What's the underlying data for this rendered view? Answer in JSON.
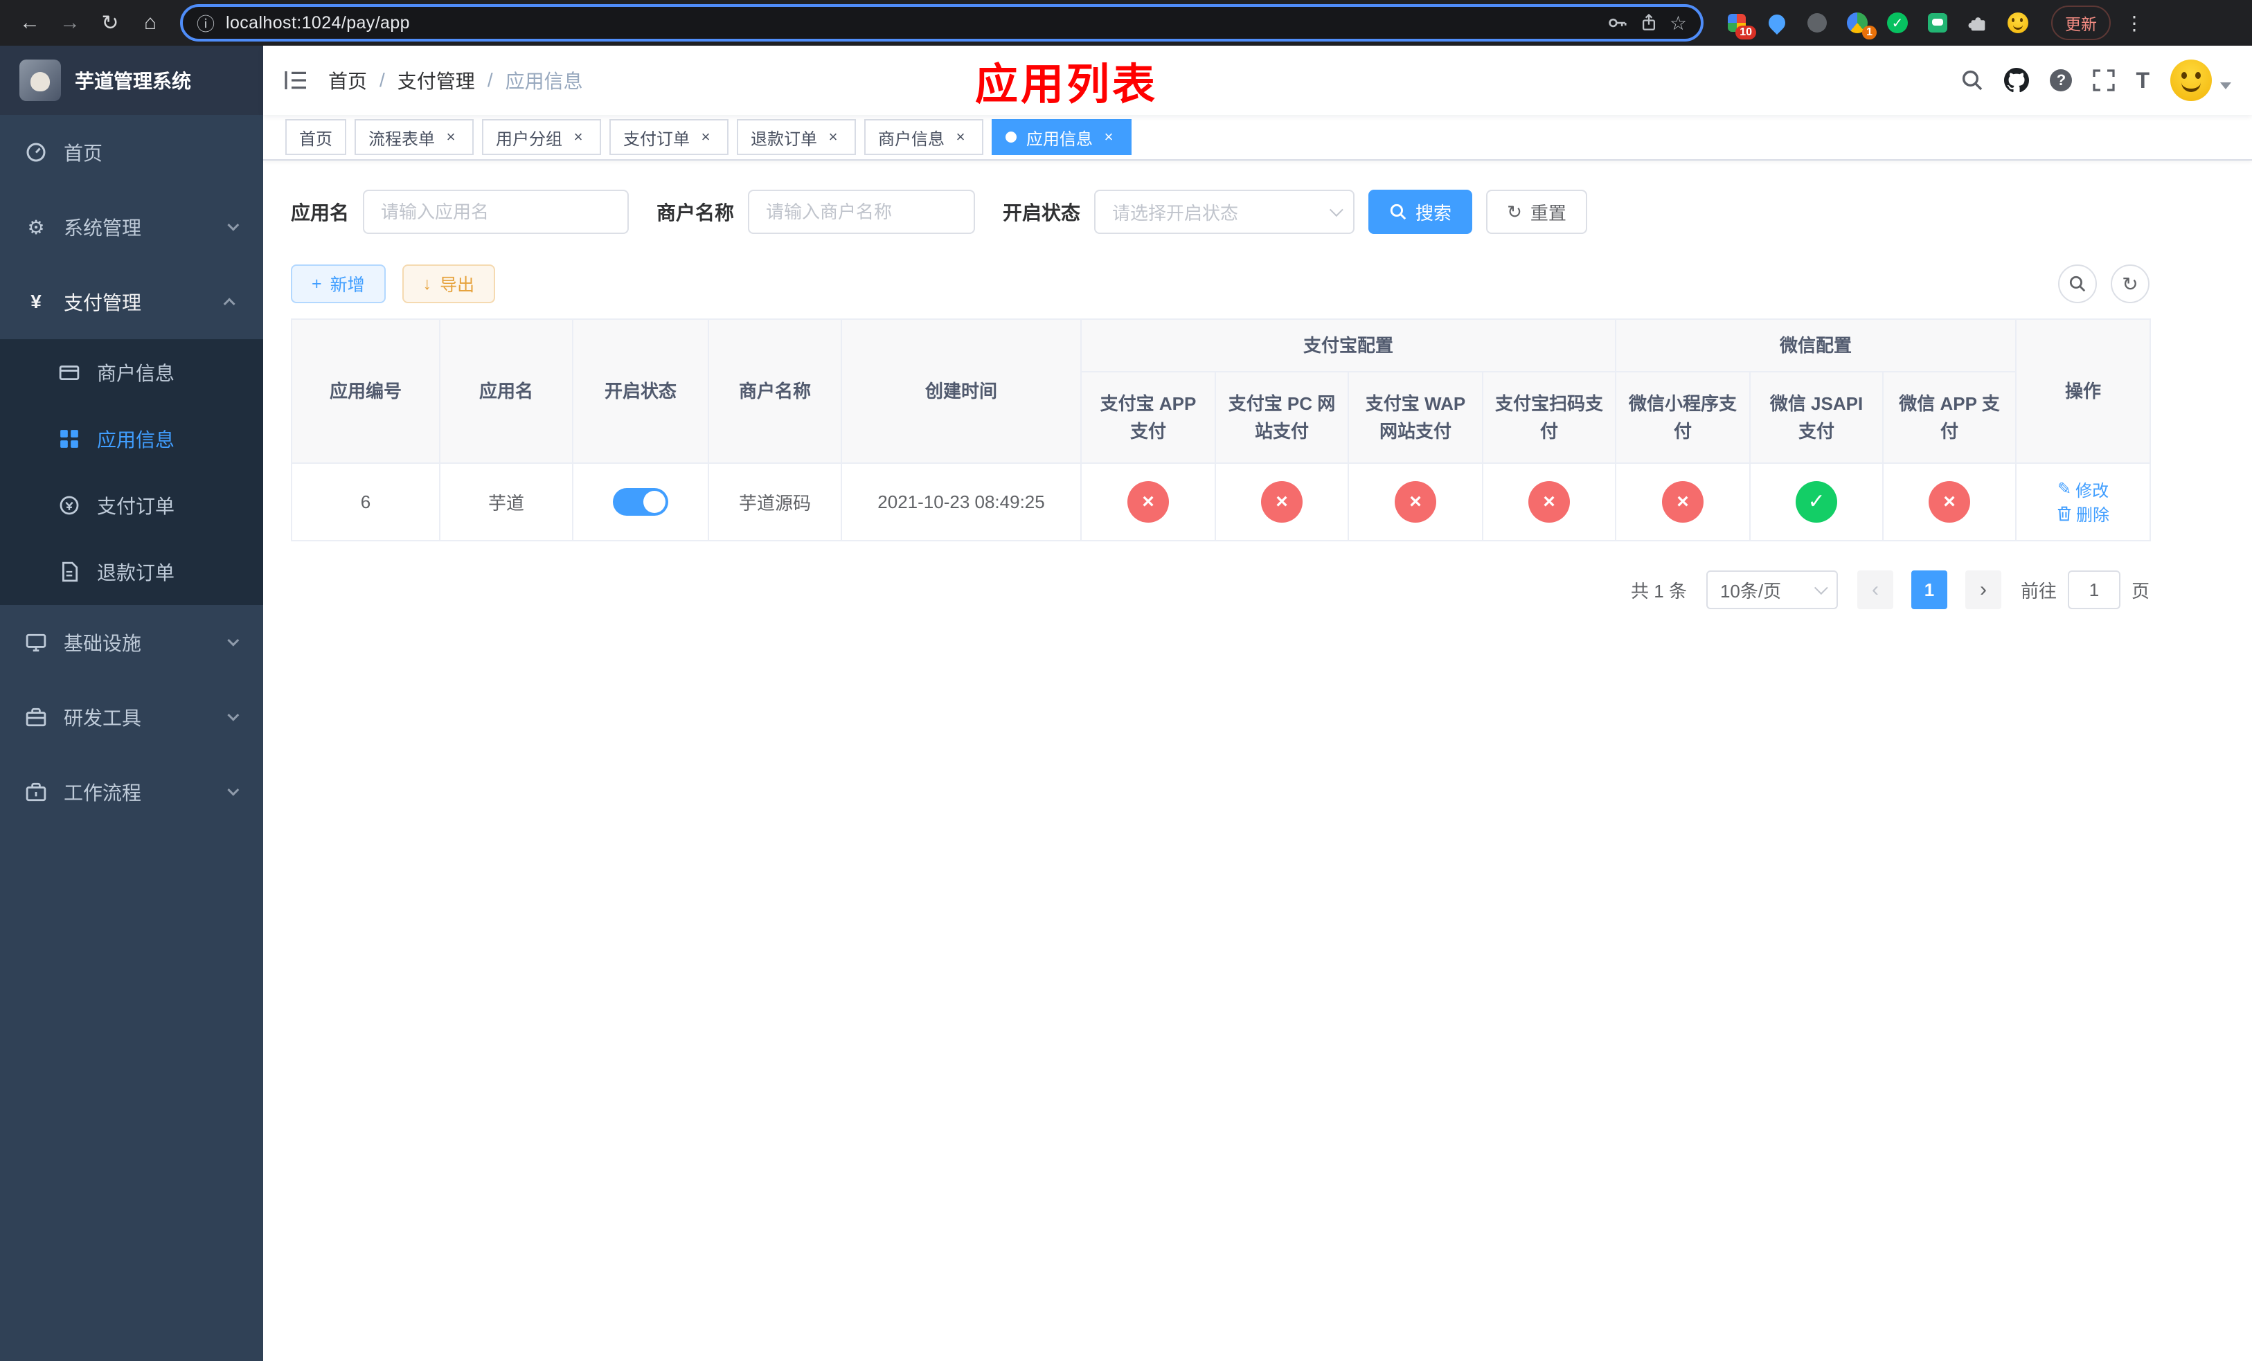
{
  "colors": {
    "accent": "#409eff",
    "danger": "#f56c6c",
    "success": "#13ce66",
    "warning": "#e6a23c",
    "title": "#ff0000",
    "sidebar_bg": "#304156",
    "sidebar_sub_bg": "#1f2d3d",
    "browser_bg": "#202124"
  },
  "icons": {
    "back": "←",
    "forward": "→",
    "reload": "↻",
    "home": "⌂",
    "info": "ⓘ",
    "star": "☆",
    "menu_dots": "⋮",
    "question": "?",
    "font_size": "T",
    "gear": "⚙",
    "yen": "¥",
    "refresh": "↻",
    "plus": "+",
    "download": "↓",
    "edit": "✎",
    "check": "✓",
    "cross": "×",
    "prev": "‹",
    "next": "›",
    "wechat_check": "✓"
  },
  "browser": {
    "url": "localhost:1024/pay/app",
    "update_label": "更新",
    "ext_badge_grid": "10",
    "ext_badge_multi": "1"
  },
  "sidebar": {
    "logo_title": "芋道管理系统",
    "items": [
      {
        "label": "首页"
      },
      {
        "label": "系统管理"
      },
      {
        "label": "支付管理",
        "children": [
          {
            "label": "商户信息"
          },
          {
            "label": "应用信息"
          },
          {
            "label": "支付订单"
          },
          {
            "label": "退款订单"
          }
        ]
      },
      {
        "label": "基础设施"
      },
      {
        "label": "研发工具"
      },
      {
        "label": "工作流程"
      }
    ]
  },
  "header": {
    "breadcrumb": [
      "首页",
      "支付管理",
      "应用信息"
    ],
    "breadcrumb_separator": "/",
    "page_title": "应用列表"
  },
  "tabbar": {
    "tabs": [
      {
        "label": "首页"
      },
      {
        "label": "流程表单"
      },
      {
        "label": "用户分组"
      },
      {
        "label": "支付订单"
      },
      {
        "label": "退款订单"
      },
      {
        "label": "商户信息"
      },
      {
        "label": "应用信息"
      }
    ]
  },
  "filters": {
    "app_name_label": "应用名",
    "app_name_placeholder": "请输入应用名",
    "merchant_name_label": "商户名称",
    "merchant_name_placeholder": "请输入商户名称",
    "status_label": "开启状态",
    "status_placeholder": "请选择开启状态",
    "search_button": "搜索",
    "reset_button": "重置"
  },
  "toolbar": {
    "add_button": "新增",
    "export_button": "导出"
  },
  "table": {
    "col_id": "应用编号",
    "col_name": "应用名",
    "col_status": "开启状态",
    "col_merchant": "商户名称",
    "col_created": "创建时间",
    "group_alipay": "支付宝配置",
    "group_wechat": "微信配置",
    "sub_columns": [
      "支付宝 APP 支付",
      "支付宝 PC 网站支付",
      "支付宝 WAP 网站支付",
      "支付宝扫码支付",
      "微信小程序支付",
      "微信 JSAPI 支付",
      "微信 APP 支付"
    ],
    "col_actions": "操作",
    "rows": [
      {
        "id": "6",
        "name": "芋道",
        "enabled": true,
        "merchant": "芋道源码",
        "created": "2021-10-23 08:49:25",
        "statuses": [
          false,
          false,
          false,
          false,
          false,
          true,
          false
        ],
        "edit_label": "修改",
        "delete_label": "删除"
      }
    ]
  },
  "pagination": {
    "total_label": "共 1 条",
    "page_size_label": "10条/页",
    "current_page": "1",
    "goto_label": "前往",
    "goto_value": "1",
    "page_unit": "页"
  }
}
